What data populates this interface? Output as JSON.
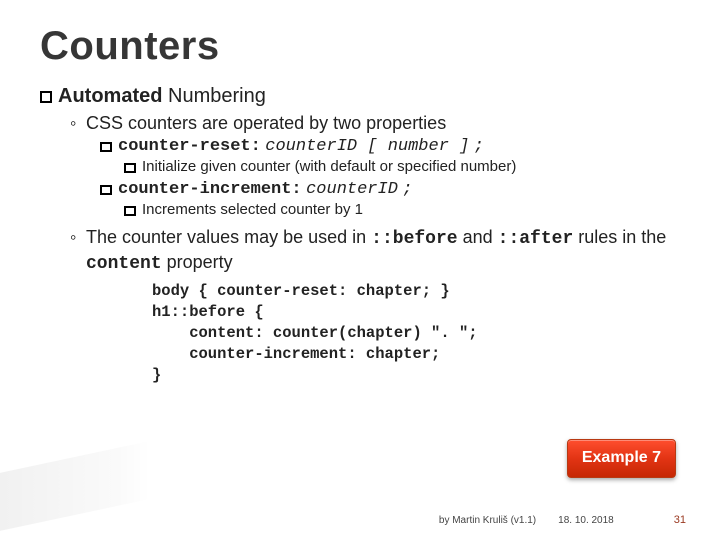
{
  "title": "Counters",
  "section": {
    "heading_strong": "Automated",
    "heading_rest": "Numbering"
  },
  "bullets": {
    "b1": "CSS counters are operated by two properties",
    "p1": {
      "name": "counter-reset:",
      "args": "counterID [ number ]",
      "tail": ";"
    },
    "p1desc": "Initialize given counter (with default or specified number)",
    "p2": {
      "name": "counter-increment:",
      "args": "counterID",
      "tail": ";"
    },
    "p2desc": "Increments selected counter by 1",
    "b2_pre": "The counter values may be used in ",
    "b2_c1": "::before",
    "b2_mid": " and ",
    "b2_c2": "::after",
    "b2_mid2": " rules in the ",
    "b2_c3": "content",
    "b2_post": " property"
  },
  "code": "body { counter-reset: chapter; }\nh1::before {\n    content: counter(chapter) \". \";\n    counter-increment: chapter;\n}",
  "badge": "Example 7",
  "footer": {
    "credit": "by Martin Kruliš (v1.1)",
    "date": "18. 10. 2018",
    "page": "31"
  }
}
